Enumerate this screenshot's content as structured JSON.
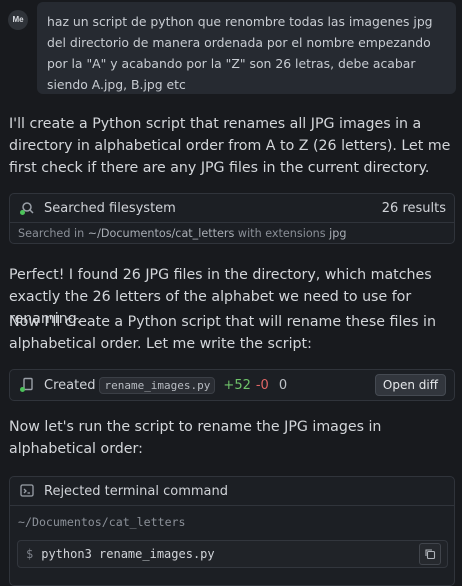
{
  "user": {
    "avatar": "Me",
    "message": "haz un script de python que renombre todas las imagenes jpg del directorio de manera ordenada por el nombre empezando por la \"A\" y acabando por la \"Z\" son 26 letras, debe acabar siendo A.jpg, B.jpg etc"
  },
  "assistant": {
    "p1": "I'll create a Python script that renames all JPG images in a directory in alphabetical order from A to Z (26 letters). Let me first check if there are any JPG files in the current directory.",
    "search_tool": {
      "icon": "search-status-icon",
      "title": "Searched filesystem",
      "count": "26 results",
      "sub_prefix": "Searched in",
      "sub_path": "~/Documentos/cat_letters",
      "sub_mid": "with extensions",
      "sub_ext": "jpg"
    },
    "p2": "Perfect! I found 26 JPG files in the directory, which matches exactly the 26 letters of the alphabet we need to use for renaming.",
    "p3": "Now I'll create a Python script that will rename these files in alphabetical order. Let me write the script:",
    "file_tool": {
      "icon": "file-status-icon",
      "label": "Created",
      "filename": "rename_images.py",
      "added": "+52",
      "removed": "-0",
      "zero": "0",
      "open_diff": "Open diff"
    },
    "p4": "Now let's run the script to rename the JPG images in alphabetical order:",
    "term_tool": {
      "icon": "terminal-icon",
      "title": "Rejected terminal command",
      "path": "~/Documentos/cat_letters",
      "prompt": "$",
      "command": "python3 rename_images.py"
    }
  },
  "colors": {
    "background": "#181a1e",
    "bubble": "#262a31",
    "added": "#6fc36a",
    "removed": "#e06666",
    "status_dot": "#4cc35a"
  }
}
